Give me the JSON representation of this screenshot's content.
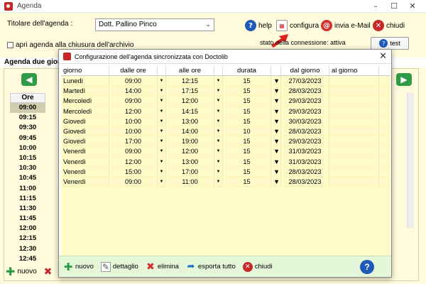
{
  "window": {
    "title": "Agenda",
    "minimize": "–",
    "maximize": "☐",
    "close": "✕"
  },
  "toolbar": {
    "owner_label": "Titolare dell'agenda :",
    "owner_value": "Dott. Pallino Pinco",
    "help_label": "help",
    "configura_label": "configura",
    "email_label": "invia e-Mail",
    "chiudi_label": "chiudi",
    "archive_label": "apri agenda alla chiusura dell'archivio",
    "connection_status": "stato della connessione: attiva",
    "test_label": "test"
  },
  "agenda": {
    "header": "Agenda due giorn",
    "ore_label": "Ore",
    "times": [
      "09:00",
      "09:15",
      "09:30",
      "09:45",
      "10:00",
      "10:15",
      "10:30",
      "10:45",
      "11:00",
      "11:15",
      "11:30",
      "11:45",
      "12:00",
      "12:15",
      "12:30",
      "12:45"
    ],
    "bottom_new": "nuovo"
  },
  "dialog": {
    "title": "Configurazione dell'agenda sincronizzata con Doctolib",
    "columns": {
      "day": "giorno",
      "from": "dalle ore",
      "to": "alle ore",
      "duration": "durata",
      "from_day": "dal giorno",
      "to_day": "al giorno"
    },
    "rows": [
      {
        "day": "Lunedì",
        "from": "09:00",
        "to": "12:15",
        "duration": "15",
        "from_day": "27/03/2023",
        "to_day": ""
      },
      {
        "day": "Martedì",
        "from": "14:00",
        "to": "17:15",
        "duration": "15",
        "from_day": "28/03/2023",
        "to_day": ""
      },
      {
        "day": "Mercoledì",
        "from": "09:00",
        "to": "12:00",
        "duration": "15",
        "from_day": "29/03/2023",
        "to_day": ""
      },
      {
        "day": "Mercoledì",
        "from": "12:00",
        "to": "14:15",
        "duration": "15",
        "from_day": "29/03/2023",
        "to_day": ""
      },
      {
        "day": "Giovedì",
        "from": "10:00",
        "to": "13:00",
        "duration": "15",
        "from_day": "30/03/2023",
        "to_day": ""
      },
      {
        "day": "Giovedì",
        "from": "10:00",
        "to": "14:00",
        "duration": "10",
        "from_day": "28/03/2023",
        "to_day": ""
      },
      {
        "day": "Giovedì",
        "from": "17:00",
        "to": "19:00",
        "duration": "15",
        "from_day": "29/03/2023",
        "to_day": ""
      },
      {
        "day": "Venerdì",
        "from": "09:00",
        "to": "12:00",
        "duration": "15",
        "from_day": "31/03/2023",
        "to_day": ""
      },
      {
        "day": "Venerdì",
        "from": "12:00",
        "to": "13:00",
        "duration": "15",
        "from_day": "31/03/2023",
        "to_day": ""
      },
      {
        "day": "Venerdì",
        "from": "15:00",
        "to": "17:00",
        "duration": "15",
        "from_day": "28/03/2023",
        "to_day": ""
      },
      {
        "day": "Venerdì",
        "from": "09:00",
        "to": "11:00",
        "duration": "15",
        "from_day": "28/03/2023",
        "to_day": ""
      }
    ],
    "footer": {
      "new": "nuovo",
      "detail": "dettaglio",
      "delete": "elimina",
      "export": "esporta tutto",
      "close": "chiudi"
    },
    "close_glyph": "✕",
    "help_glyph": "?"
  }
}
